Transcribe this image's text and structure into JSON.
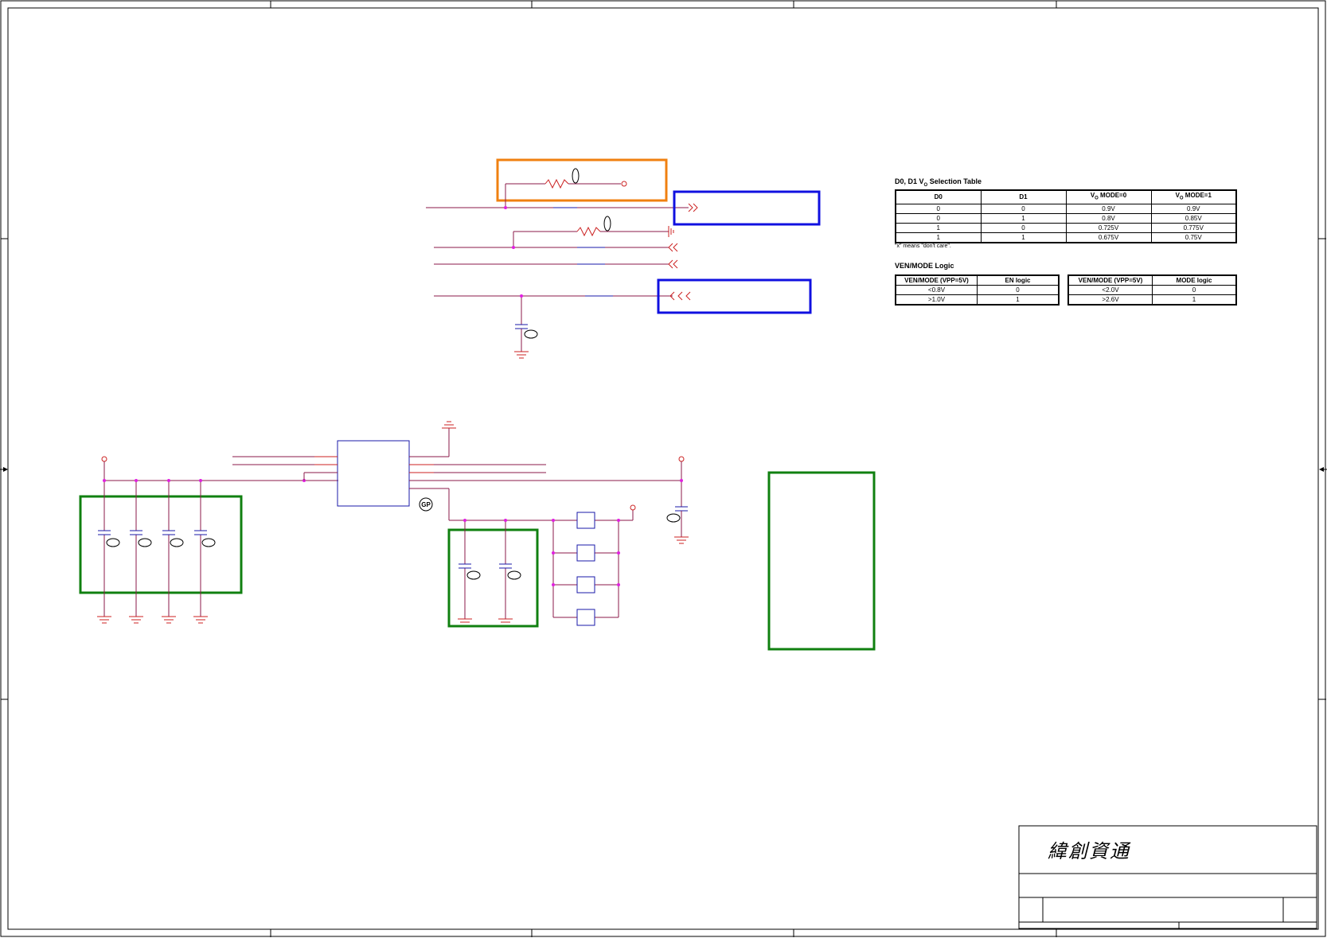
{
  "selection_table": {
    "title": "D0, D1 V",
    "title_sub": "O",
    "title_rest": " Selection Table",
    "headers": [
      "D0",
      "D1",
      "V",
      "V"
    ],
    "header_sub": "O",
    "header_rest": [
      " MODE=0",
      " MODE=1"
    ],
    "rows": [
      [
        "0",
        "0",
        "0.9V",
        "0.9V"
      ],
      [
        "0",
        "1",
        "0.8V",
        "0.85V"
      ],
      [
        "1",
        "0",
        "0.725V",
        "0.775V"
      ],
      [
        "1",
        "1",
        "0.675V",
        "0.75V"
      ]
    ],
    "note": "\"x\" means \"don't care\"."
  },
  "logic_section": {
    "title": "VEN/MODE Logic",
    "en_table": {
      "headers": [
        "VEN/MODE (VPP=5V)",
        "EN logic"
      ],
      "rows": [
        [
          "<0.8V",
          "0"
        ],
        [
          ">1.0V",
          "1"
        ]
      ]
    },
    "mode_table": {
      "headers": [
        "VEN/MODE (VPP=5V)",
        "MODE logic"
      ],
      "rows": [
        [
          "<2.0V",
          "0"
        ],
        [
          ">2.6V",
          "1"
        ]
      ]
    }
  },
  "title_block": {
    "company": "緯創資通"
  },
  "symbols": {
    "gp_label": "GP"
  },
  "colors": {
    "wire": "#8b1a4a",
    "component": "#1a1aaa",
    "power": "#cc2222",
    "junction": "#e020e0",
    "highlight_orange": "#f08010",
    "highlight_blue": "#1010e0",
    "highlight_green": "#108010"
  }
}
